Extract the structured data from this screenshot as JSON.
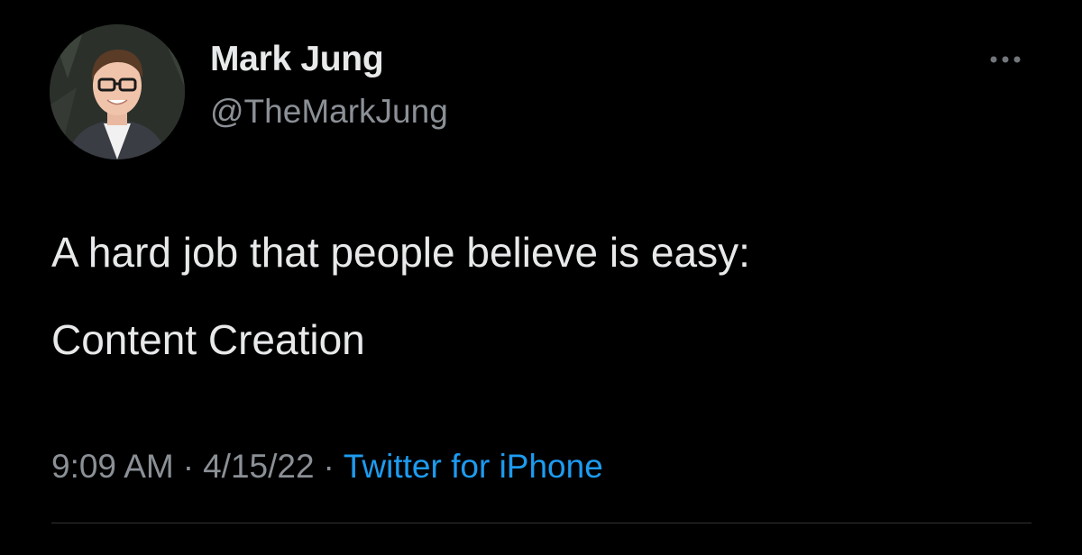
{
  "author": {
    "display_name": "Mark Jung",
    "handle": "@TheMarkJung",
    "avatar_icon": "profile-photo"
  },
  "more_icon": "more-dots-icon",
  "tweet": {
    "line_1": "A hard job that people believe is easy:",
    "line_2": "Content Creation"
  },
  "meta": {
    "time": "9:09 AM",
    "separator": "·",
    "date": "4/15/22",
    "source": "Twitter for iPhone"
  },
  "colors": {
    "background": "#000000",
    "primary_text": "#e7e9ea",
    "secondary_text": "#8b9096",
    "link": "#1d9bf0",
    "divider": "#2f3336"
  }
}
